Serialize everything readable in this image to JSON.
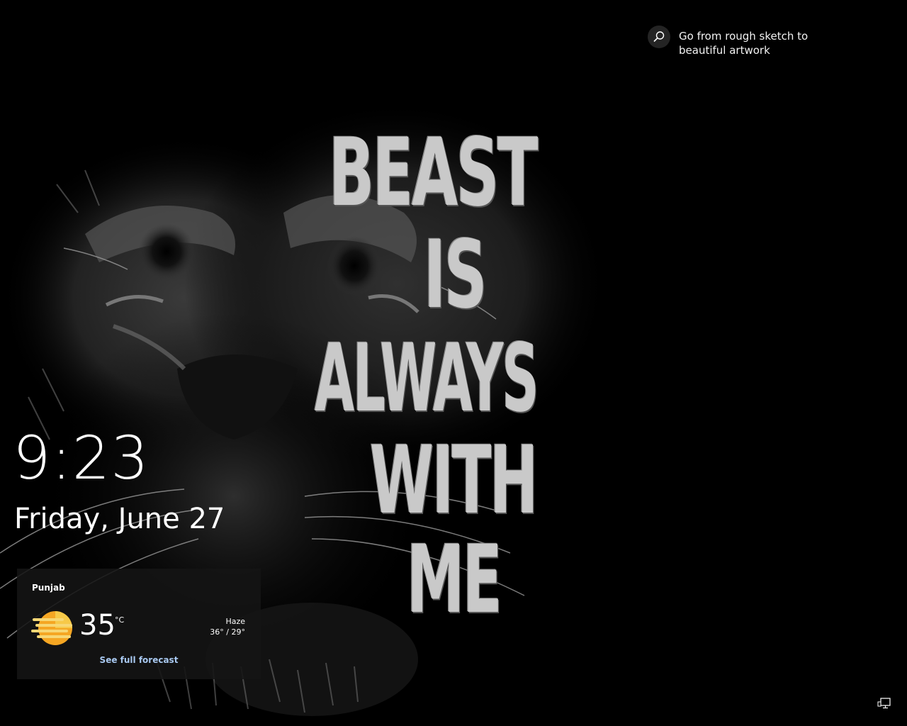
{
  "spotlight": {
    "text": "Go from rough sketch to beautiful artwork",
    "icon": "search-icon"
  },
  "clock": {
    "time": "9:23",
    "date": "Friday, June 27"
  },
  "weather": {
    "location": "Punjab",
    "temperature": "35",
    "unit": "°C",
    "condition": "Haze",
    "range": "36° / 29°",
    "link_label": "See full forecast",
    "icon": "haze-sun-icon",
    "icon_colors": [
      "#f5a623",
      "#f7c948"
    ]
  },
  "wallpaper": {
    "lines": [
      "BEAST",
      "IS",
      "ALWAYS",
      "WITH",
      "ME"
    ]
  },
  "network": {
    "icon": "network-icon"
  },
  "colors": {
    "background": "#000000",
    "card": "#141414",
    "link": "#a8c8f0"
  }
}
